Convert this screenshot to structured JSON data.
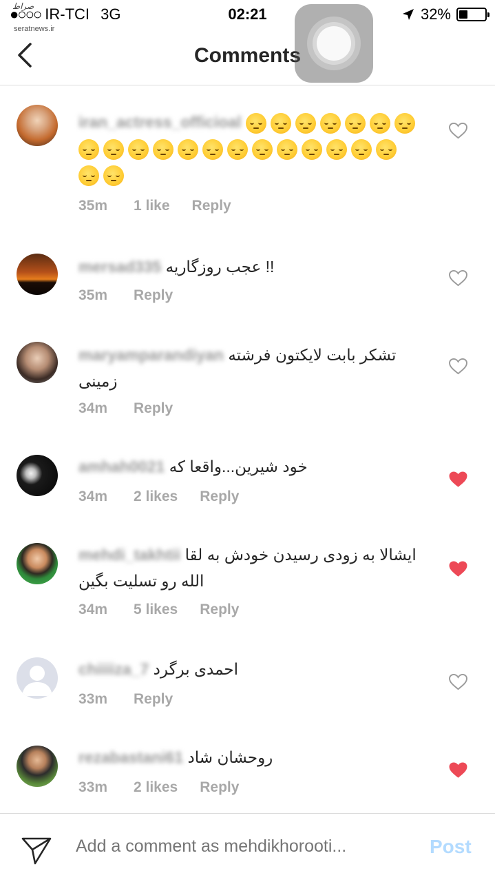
{
  "status_bar": {
    "signal_dots": "●○○○",
    "carrier": "IR-TCI",
    "network": "3G",
    "time": "02:21",
    "battery": "32%",
    "battery_level": 0.32
  },
  "watermark": {
    "logo_text": "صراط",
    "site": "seratnews.ir"
  },
  "nav": {
    "title": "Comments"
  },
  "comments": [
    {
      "username": "iran_actress_officioal",
      "text": "",
      "emoji_count": 22,
      "time": "35m",
      "likes": "1 like",
      "reply": "Reply",
      "liked": false
    },
    {
      "username": "mersad335",
      "text": "عجب روزگاریه !!",
      "time": "35m",
      "likes": "",
      "reply": "Reply",
      "liked": false
    },
    {
      "username": "maryamparandiyan",
      "text": "تشکر بابت لایکتون فرشته زمینی",
      "time": "34m",
      "likes": "",
      "reply": "Reply",
      "liked": false
    },
    {
      "username": "amhah0021",
      "text": "خود شیرین...واقعا که",
      "time": "34m",
      "likes": "2 likes",
      "reply": "Reply",
      "liked": true
    },
    {
      "username": "mehdi_takhtii",
      "text": "ایشالا به زودی رسیدن خودش به لقا الله رو تسلیت بگین",
      "time": "34m",
      "likes": "5 likes",
      "reply": "Reply",
      "liked": true
    },
    {
      "username": "chiiiiza_7",
      "text": "احمدی برگرد",
      "time": "33m",
      "likes": "",
      "reply": "Reply",
      "liked": false
    },
    {
      "username": "rezabastani61",
      "text": "روحشان شاد",
      "time": "33m",
      "likes": "2 likes",
      "reply": "Reply",
      "liked": true
    }
  ],
  "composer": {
    "placeholder": "Add a comment as mehdikhorooti...",
    "post_label": "Post"
  },
  "colors": {
    "liked_heart": "#ed4956",
    "unliked_heart": "#9b9b9b",
    "post_disabled": "#b3dbff"
  }
}
